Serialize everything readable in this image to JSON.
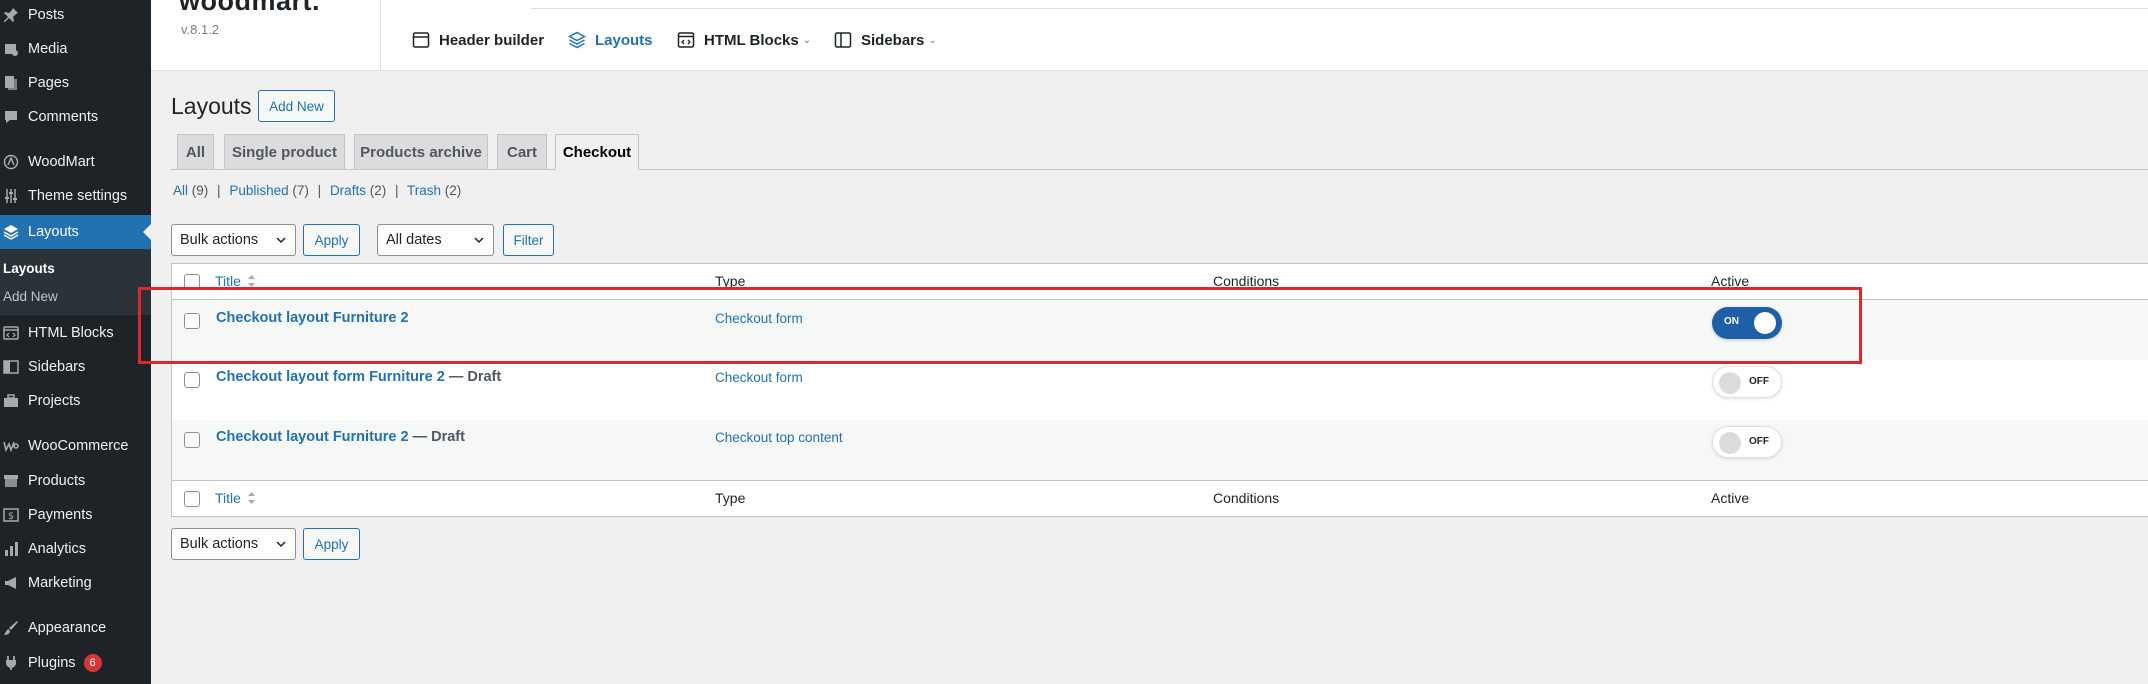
{
  "sidebar": {
    "items": [
      {
        "label": "Posts",
        "icon": "pushpin-icon"
      },
      {
        "label": "Media",
        "icon": "media-icon"
      },
      {
        "label": "Pages",
        "icon": "pages-icon"
      },
      {
        "label": "Comments",
        "icon": "comment-icon"
      },
      {
        "label": "WoodMart",
        "icon": "woodmart-icon"
      },
      {
        "label": "Theme settings",
        "icon": "sliders-icon"
      },
      {
        "label": "Layouts",
        "icon": "layers-icon"
      },
      {
        "label": "HTML Blocks",
        "icon": "html-block-icon"
      },
      {
        "label": "Sidebars",
        "icon": "sidebar-icon"
      },
      {
        "label": "Projects",
        "icon": "briefcase-icon"
      },
      {
        "label": "WooCommerce",
        "icon": "woocommerce-icon"
      },
      {
        "label": "Products",
        "icon": "archive-icon"
      },
      {
        "label": "Payments",
        "icon": "payments-icon"
      },
      {
        "label": "Analytics",
        "icon": "bar-chart-icon"
      },
      {
        "label": "Marketing",
        "icon": "megaphone-icon"
      },
      {
        "label": "Appearance",
        "icon": "brush-icon"
      },
      {
        "label": "Plugins",
        "icon": "plug-icon",
        "badge": "6"
      }
    ],
    "submenu": {
      "current": "Layouts",
      "add_new": "Add New"
    }
  },
  "header": {
    "logo": "woodmart.",
    "version": "v.8.1.2",
    "nav": [
      {
        "label": "Header builder",
        "icon": "header-builder-icon"
      },
      {
        "label": "Layouts",
        "icon": "layers-icon"
      },
      {
        "label": "HTML Blocks",
        "icon": "html-block-icon"
      },
      {
        "label": "Sidebars",
        "icon": "sidebar-icon"
      }
    ]
  },
  "page": {
    "title": "Layouts",
    "add_new": "Add New",
    "tabs": [
      "All",
      "Single product",
      "Products archive",
      "Cart",
      "Checkout"
    ],
    "active_tab": "Checkout",
    "views": [
      {
        "label": "All",
        "count": "(9)"
      },
      {
        "label": "Published",
        "count": "(7)"
      },
      {
        "label": "Drafts",
        "count": "(2)"
      },
      {
        "label": "Trash",
        "count": "(2)"
      }
    ],
    "views_separator": "|",
    "bulk_actions": "Bulk actions",
    "apply": "Apply",
    "all_dates": "All dates",
    "filter": "Filter"
  },
  "table": {
    "columns": [
      "Title",
      "Type",
      "Conditions",
      "Active"
    ],
    "rows": [
      {
        "title": "Checkout layout Furniture 2",
        "state": "",
        "type": "Checkout form",
        "active": "ON"
      },
      {
        "title": "Checkout layout form Furniture 2",
        "state": " — Draft",
        "type": "Checkout form",
        "active": "OFF"
      },
      {
        "title": "Checkout layout Furniture 2",
        "state": " — Draft",
        "type": "Checkout top content",
        "active": "OFF"
      }
    ]
  },
  "colors": {
    "accent": "#2271b1",
    "sidebar_bg": "#1d2327",
    "highlight": "#e0262b",
    "toggle_on": "#1e5fa8"
  }
}
